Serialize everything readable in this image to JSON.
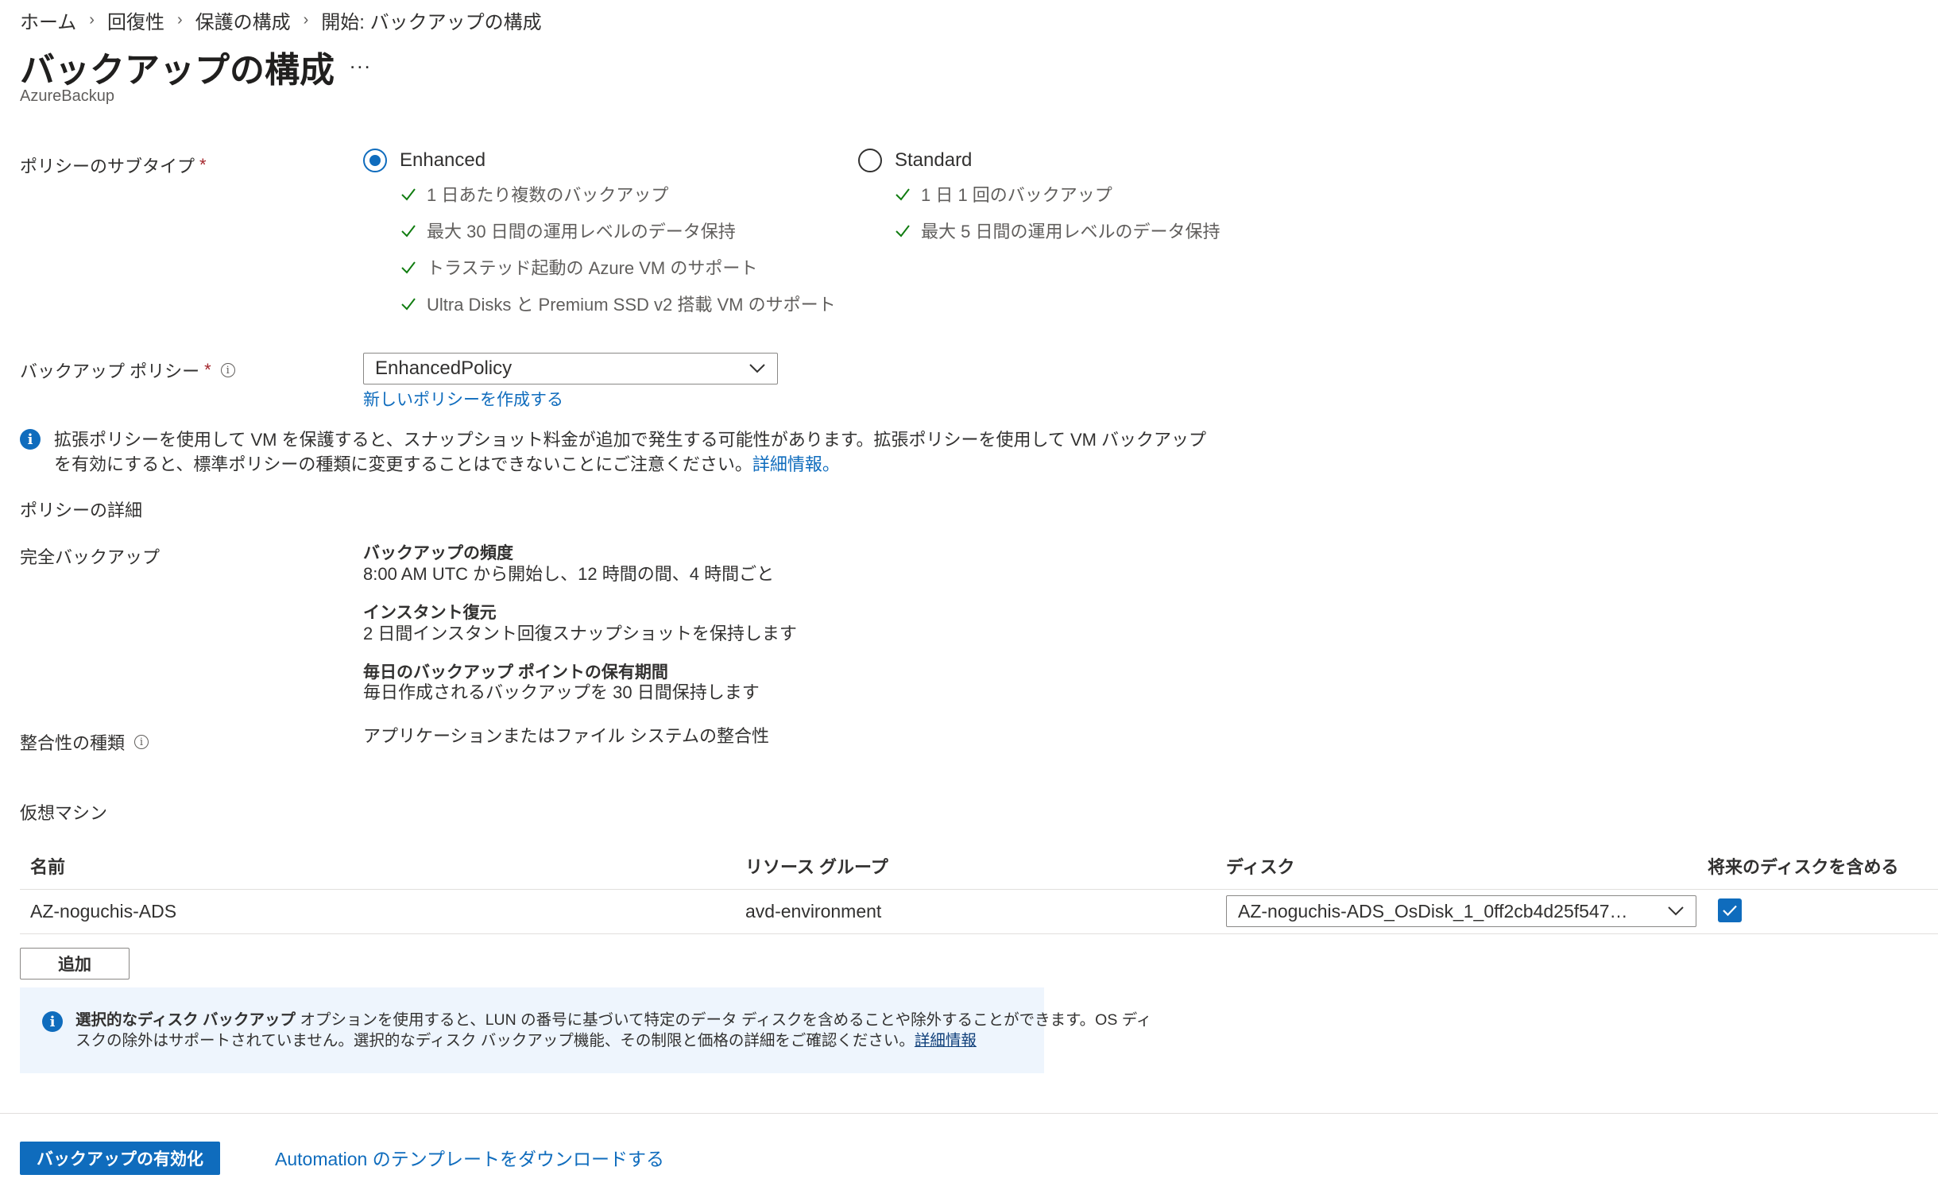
{
  "breadcrumb": [
    "ホーム",
    "回復性",
    "保護の構成",
    "開始: バックアップの構成"
  ],
  "page": {
    "title": "バックアップの構成",
    "more": "...",
    "subtitle": "AzureBackup"
  },
  "policy_subtype": {
    "label": "ポリシーのサブタイプ",
    "required": "*",
    "options": [
      {
        "label": "Enhanced",
        "selected": true,
        "features": [
          "1 日あたり複数のバックアップ",
          "最大 30 日間の運用レベルのデータ保持",
          "トラステッド起動の Azure VM のサポート",
          "Ultra Disks と Premium SSD v2 搭載 VM のサポート"
        ]
      },
      {
        "label": "Standard",
        "selected": false,
        "features": [
          "1 日 1 回のバックアップ",
          "最大 5 日間の運用レベルのデータ保持"
        ]
      }
    ]
  },
  "backup_policy": {
    "label": "バックアップ ポリシー",
    "required": "*",
    "value": "EnhancedPolicy",
    "create_link": "新しいポリシーを作成する"
  },
  "notice": {
    "line1": "拡張ポリシーを使用して VM を保護すると、スナップショット料金が追加で発生する可能性があります。拡張ポリシーを使用して VM バックアップ",
    "line2": "を有効にすると、標準ポリシーの種類に変更することはできないことにご注意ください。",
    "link": "詳細情報。"
  },
  "policy_details": {
    "heading": "ポリシーの詳細",
    "full_backup_label": "完全バックアップ",
    "frequency_title": "バックアップの頻度",
    "frequency_value": "8:00 AM UTC から開始し、12 時間の間、4 時間ごと",
    "instant_title": "インスタント復元",
    "instant_value": "2 日間インスタント回復スナップショットを保持します",
    "daily_title": "毎日のバックアップ ポイントの保有期間",
    "daily_value": "毎日作成されるバックアップを 30 日間保持します",
    "consistency_label": "整合性の種類",
    "consistency_value": "アプリケーションまたはファイル システムの整合性"
  },
  "vms": {
    "heading": "仮想マシン",
    "columns": [
      "名前",
      "リソース グループ",
      "ディスク",
      "将来のディスクを含める"
    ],
    "rows": [
      {
        "name": "AZ-noguchis-ADS",
        "resource_group": "avd-environment",
        "disk": "AZ-noguchis-ADS_OsDisk_1_0ff2cb4d25f547…",
        "include_future": true
      }
    ],
    "add_button": "追加"
  },
  "selective": {
    "bold": "選択的なディスク バックアップ",
    "line1": " オプションを使用すると、LUN の番号に基づいて特定のデータ ディスクを含めることや除外することができます。OS ディ",
    "line2": "スクの除外はサポートされていません。選択的なディスク バックアップ機能、その制限と価格の詳細をご確認ください。",
    "link": "詳細情報"
  },
  "footer": {
    "primary": "バックアップの有効化",
    "download_link": "Automation のテンプレートをダウンロードする"
  },
  "colors": {
    "accent": "#0f6cbd",
    "required": "#a4262c",
    "check": "#107c10",
    "info_bg": "#eef5fd"
  },
  "icons": [
    "chevron-right-icon",
    "more-icon",
    "checkmark-icon",
    "info-icon",
    "chevron-down-icon"
  ]
}
